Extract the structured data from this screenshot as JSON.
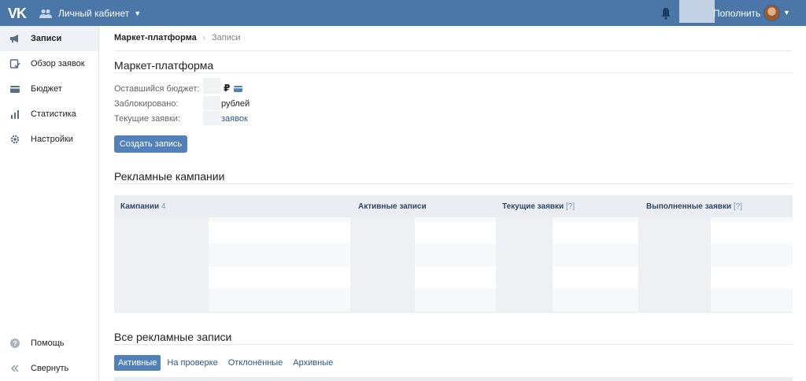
{
  "topbar": {
    "logo": "VK",
    "account_label": "Личный кабинет",
    "topup_label": "Пополнить"
  },
  "sidebar": {
    "items": [
      {
        "label": "Записи",
        "icon": "megaphone-icon",
        "active": true
      },
      {
        "label": "Обзор заявок",
        "icon": "review-icon",
        "active": false
      },
      {
        "label": "Бюджет",
        "icon": "wallet-icon",
        "active": false
      },
      {
        "label": "Статистика",
        "icon": "bar-chart-icon",
        "active": false
      },
      {
        "label": "Настройки",
        "icon": "gear-icon",
        "active": false
      }
    ],
    "help_label": "Помощь",
    "collapse_label": "Свернуть"
  },
  "breadcrumb": {
    "main": "Маркет-платформа",
    "separator": "›",
    "current": "Записи"
  },
  "summary": {
    "title": "Маркет-платформа",
    "budget_label": "Оставшийся бюджет:",
    "currency_symbol": "₽",
    "blocked_label": "Заблокировано:",
    "blocked_unit": "рублей",
    "requests_label": "Текущие заявки:",
    "requests_unit": "заявок",
    "create_button": "Создать запись"
  },
  "campaigns": {
    "title": "Рекламные кампании",
    "columns": [
      {
        "label": "Кампании",
        "count": "4"
      },
      {
        "label": "Активные записи"
      },
      {
        "label": "Текущие заявки",
        "hint": "[?]"
      },
      {
        "label": "Выполненные заявки",
        "hint": "[?]"
      }
    ]
  },
  "all_posts": {
    "title": "Все рекламные записи",
    "tabs": [
      {
        "label": "Активные",
        "active": true
      },
      {
        "label": "На проверке",
        "active": false
      },
      {
        "label": "Отклонённые",
        "active": false
      },
      {
        "label": "Архивные",
        "active": false
      }
    ]
  },
  "colors": {
    "header": "#4a76a8",
    "accent": "#5181b8",
    "link": "#2a5885"
  }
}
